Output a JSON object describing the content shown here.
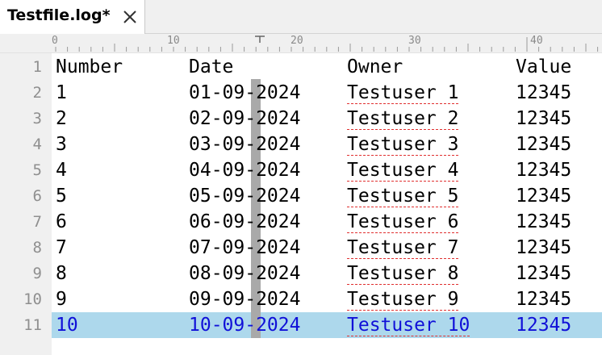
{
  "tab": {
    "title": "Testfile.log*",
    "close_icon": "close-icon"
  },
  "ruler": {
    "labels": [
      "0",
      "10",
      "20",
      "30",
      "40"
    ]
  },
  "editor": {
    "line_numbers": [
      "1",
      "2",
      "3",
      "4",
      "5",
      "6",
      "7",
      "8",
      "9",
      "10",
      "11"
    ],
    "header": {
      "number": "Number",
      "date": "Date",
      "owner": "Owner",
      "value": "Value"
    },
    "rows": [
      {
        "number": "1",
        "date": "01-09-2024",
        "owner": "Testuser 1",
        "value": "12345"
      },
      {
        "number": "2",
        "date": "02-09-2024",
        "owner": "Testuser 2",
        "value": "12345"
      },
      {
        "number": "3",
        "date": "03-09-2024",
        "owner": "Testuser 3",
        "value": "12345"
      },
      {
        "number": "4",
        "date": "04-09-2024",
        "owner": "Testuser 4",
        "value": "12345"
      },
      {
        "number": "5",
        "date": "05-09-2024",
        "owner": "Testuser 5",
        "value": "12345"
      },
      {
        "number": "6",
        "date": "06-09-2024",
        "owner": "Testuser 6",
        "value": "12345"
      },
      {
        "number": "7",
        "date": "07-09-2024",
        "owner": "Testuser 7",
        "value": "12345"
      },
      {
        "number": "8",
        "date": "08-09-2024",
        "owner": "Testuser 8",
        "value": "12345"
      },
      {
        "number": "9",
        "date": "09-09-2024",
        "owner": "Testuser 9",
        "value": "12345"
      },
      {
        "number": "10",
        "date": "10-09-2024",
        "owner": "Testuser 10",
        "value": "12345"
      }
    ]
  },
  "colors": {
    "current_line_bg": "#add8ec",
    "current_line_text": "#1010d8",
    "column_marker": "#a9a9a9",
    "spellcheck_underline": "#e03030"
  }
}
